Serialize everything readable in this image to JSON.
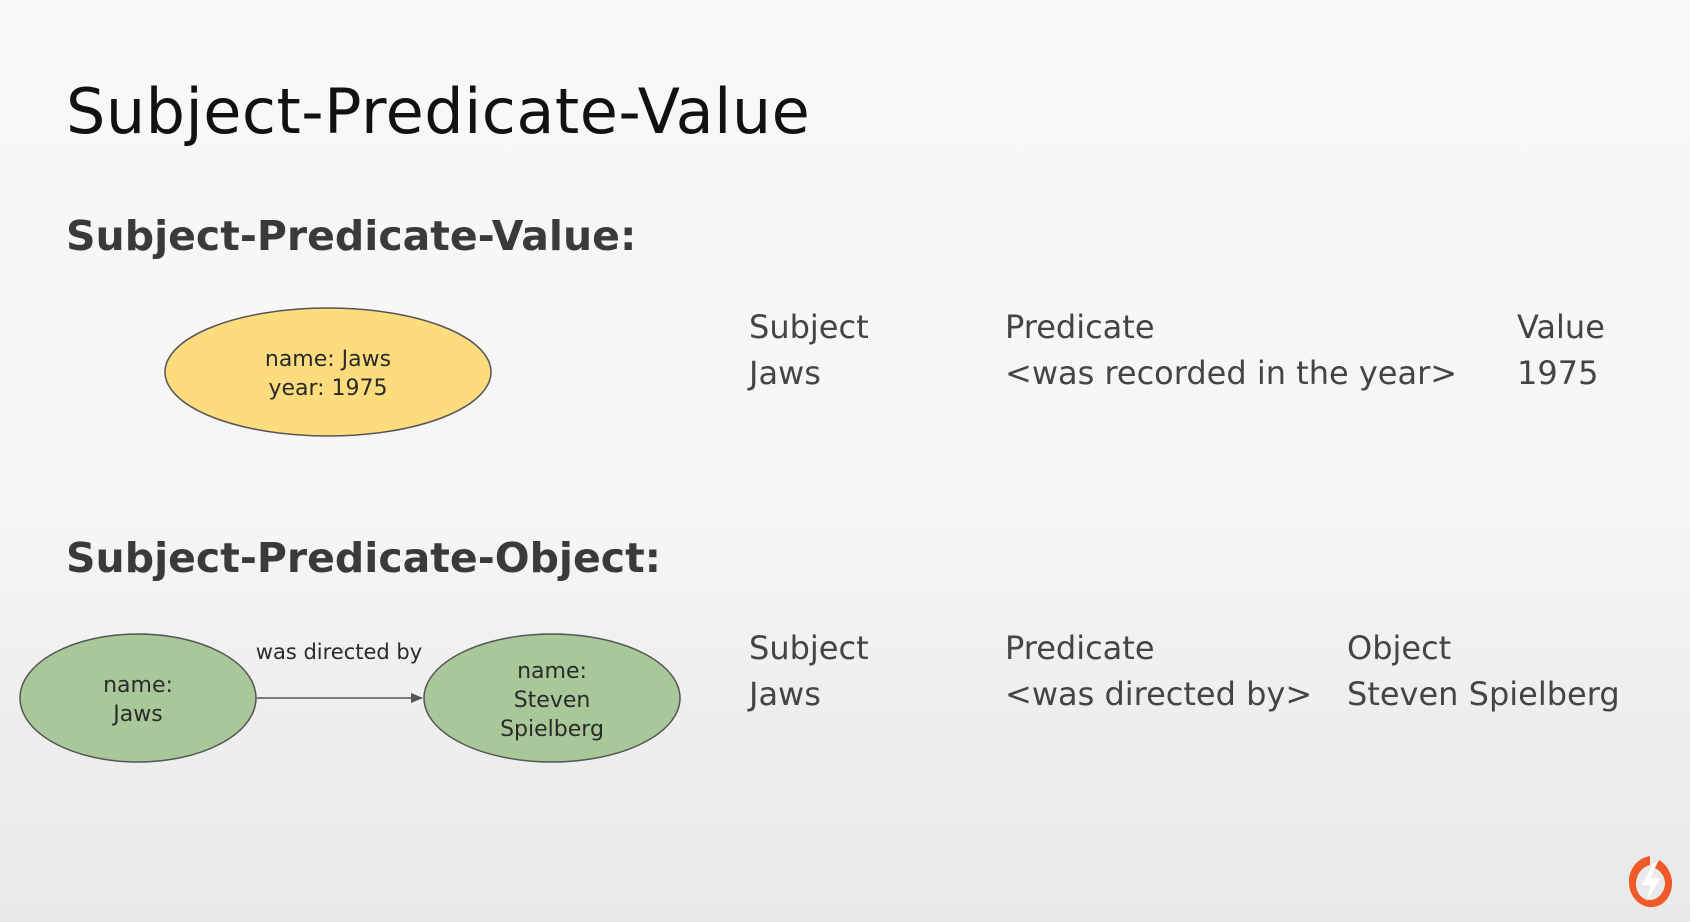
{
  "slide": {
    "title": "Subject-Predicate-Value"
  },
  "spv": {
    "heading": "Subject-Predicate-Value:",
    "node": {
      "line1": "name: Jaws",
      "line2": "year: 1975",
      "color": "#fddc7e"
    },
    "table": {
      "headers": [
        "Subject",
        "Predicate",
        "Value"
      ],
      "row": [
        "Jaws",
        "<was recorded in the year>",
        "1975"
      ]
    }
  },
  "spo": {
    "heading": "Subject-Predicate-Object:",
    "subject_node": {
      "line1": "name:",
      "line2": "Jaws",
      "color": "#a9c89a"
    },
    "edge_label": "was directed by",
    "object_node": {
      "line1": "name:",
      "line2": "Steven",
      "line3": "Spielberg",
      "color": "#a9c89a"
    },
    "table": {
      "headers": [
        "Subject",
        "Predicate",
        "Object"
      ],
      "row": [
        "Jaws",
        "<was directed by>",
        "Steven Spielberg"
      ]
    }
  },
  "logo": {
    "icon": "lightning-bolt-logo",
    "color": "#f05a28"
  }
}
